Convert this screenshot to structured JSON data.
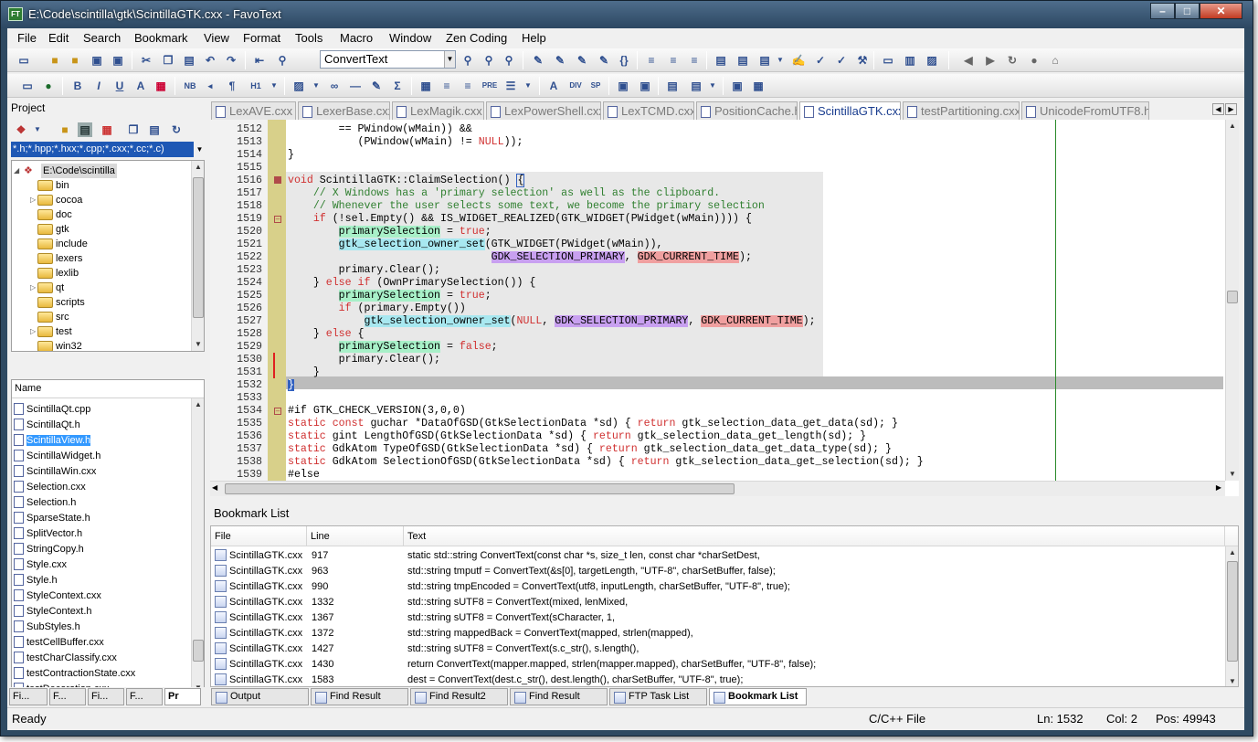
{
  "window": {
    "title": "E:\\Code\\scintilla\\gtk\\ScintillaGTK.cxx - FavoText",
    "app_icon": "FT",
    "min": "–",
    "max": "□",
    "close": "✕"
  },
  "menu": [
    "File",
    "Edit",
    "Search",
    "Bookmark",
    "View",
    "Format",
    "Tools",
    "Macro",
    "Window",
    "Zen Coding",
    "Help"
  ],
  "toolbar1": {
    "combo_value": "ConvertText"
  },
  "toolbar2": {
    "labels": [
      "B",
      "I",
      "U",
      "A",
      "NB",
      "¶",
      "H1",
      "Σ",
      "PRE",
      "DIV",
      "SP"
    ]
  },
  "project": {
    "header": "Project",
    "filter": "*.h;*.hpp;*.hxx;*.cpp;*.cxx;*.cc;*.c)",
    "root": "E:\\Code\\scintilla",
    "folders": [
      "bin",
      "cocoa",
      "doc",
      "gtk",
      "include",
      "lexers",
      "lexlib",
      "qt",
      "scripts",
      "src",
      "test",
      "win32"
    ]
  },
  "files": {
    "header": "Name",
    "items": [
      "ScintillaQt.cpp",
      "ScintillaQt.h",
      "ScintillaView.h",
      "ScintillaWidget.h",
      "ScintillaWin.cxx",
      "Selection.cxx",
      "Selection.h",
      "SparseState.h",
      "SplitVector.h",
      "StringCopy.h",
      "Style.cxx",
      "Style.h",
      "StyleContext.cxx",
      "StyleContext.h",
      "SubStyles.h",
      "testCellBuffer.cxx",
      "testCharClassify.cxx",
      "testContractionState.cxx",
      "testDecoration.cxx"
    ],
    "selected": "ScintillaView.h"
  },
  "left_tabs": [
    "Fi...",
    "F...",
    "Fi...",
    "F...",
    "Pr"
  ],
  "doc_tabs": [
    "LexAVE.cxx",
    "LexerBase.cxx",
    "LexMagik.cxx",
    "LexPowerShell.cxx",
    "LexTCMD.cxx",
    "PositionCache.h",
    "ScintillaGTK.cxx",
    "testPartitioning.cxx",
    "UnicodeFromUTF8.h"
  ],
  "active_tab": "ScintillaGTK.cxx",
  "editor": {
    "line_numbers": [
      "1512",
      "1513",
      "1514",
      "1515",
      "1516",
      "1517",
      "1518",
      "1519",
      "1520",
      "1521",
      "1522",
      "1523",
      "1524",
      "1525",
      "1526",
      "1527",
      "1528",
      "1529",
      "1530",
      "1531",
      "1532",
      "1533",
      "1534",
      "1535",
      "1536",
      "1537",
      "1538",
      "1539"
    ]
  },
  "bookmarks": {
    "title": "Bookmark List",
    "columns": [
      "File",
      "Line",
      "Text"
    ],
    "rows": [
      {
        "file": "ScintillaGTK.cxx",
        "line": "917",
        "text": "static std::string ConvertText(const char *s, size_t len, const char *charSetDest,"
      },
      {
        "file": "ScintillaGTK.cxx",
        "line": "963",
        "text": "std::string tmputf = ConvertText(&s[0], targetLength, \"UTF-8\", charSetBuffer, false);"
      },
      {
        "file": "ScintillaGTK.cxx",
        "line": "990",
        "text": "std::string tmpEncoded = ConvertText(utf8, inputLength, charSetBuffer, \"UTF-8\", true);"
      },
      {
        "file": "ScintillaGTK.cxx",
        "line": "1332",
        "text": "std::string sUTF8 = ConvertText(mixed, lenMixed,"
      },
      {
        "file": "ScintillaGTK.cxx",
        "line": "1367",
        "text": "std::string sUTF8 = ConvertText(sCharacter, 1,"
      },
      {
        "file": "ScintillaGTK.cxx",
        "line": "1372",
        "text": "std::string mappedBack = ConvertText(mapped, strlen(mapped),"
      },
      {
        "file": "ScintillaGTK.cxx",
        "line": "1427",
        "text": "std::string sUTF8 = ConvertText(s.c_str(), s.length(),"
      },
      {
        "file": "ScintillaGTK.cxx",
        "line": "1430",
        "text": "return ConvertText(mapper.mapped, strlen(mapper.mapped), charSetBuffer, \"UTF-8\", false);"
      },
      {
        "file": "ScintillaGTK.cxx",
        "line": "1583",
        "text": "dest = ConvertText(dest.c_str(), dest.length(), charSetBuffer, \"UTF-8\", true);"
      }
    ]
  },
  "bottom_tabs": [
    "Output",
    "Find Result",
    "Find Result2",
    "Find Result",
    "FTP Task List",
    "Bookmark List"
  ],
  "status": {
    "left": "Ready",
    "language": "C/C++ File",
    "line": "Ln: 1532",
    "col": "Col: 2",
    "pos": "Pos: 49943"
  },
  "icons": [
    "new-file-icon",
    "open-folder-icon",
    "save-icon",
    "save-all-icon",
    "cut-icon",
    "copy-icon",
    "paste-icon",
    "undo-icon",
    "redo-icon",
    "find-icon",
    "replace-icon",
    "back-arrow-icon",
    "forward-arrow-icon",
    "refresh-icon",
    "stop-icon",
    "home-icon",
    "bold-icon",
    "italic-icon",
    "underline-icon",
    "table-icon",
    "image-icon"
  ],
  "colors": {
    "titlebar": "#2c4762",
    "selection": "#3399ff",
    "keyword": "#d03030",
    "comment": "#2f7f2f",
    "fold_margin": "#d8d08a"
  }
}
